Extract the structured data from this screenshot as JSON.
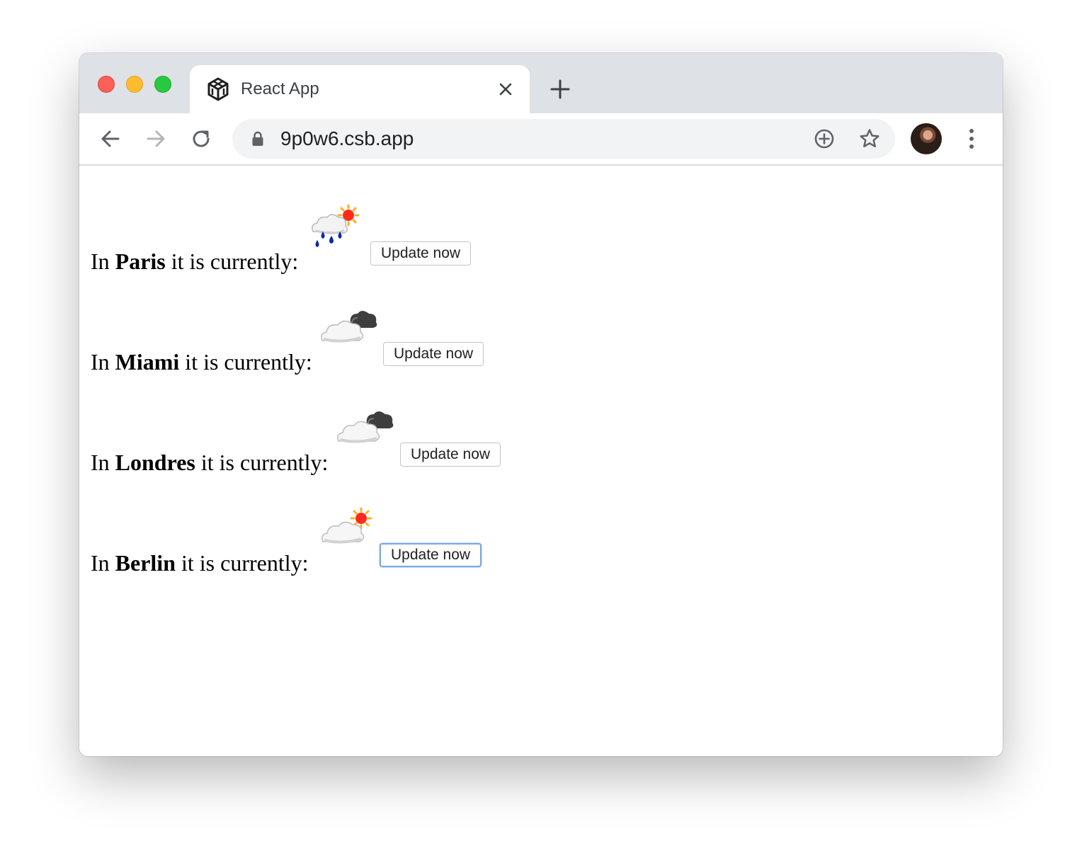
{
  "browser": {
    "tab_title": "React App",
    "url": "9p0w6.csb.app"
  },
  "content": {
    "rows": [
      {
        "prefix": "In ",
        "city": "Paris",
        "suffix": " it is currently:",
        "weather": "rain-sun-icon",
        "button_label": "Update now"
      },
      {
        "prefix": "In ",
        "city": "Miami",
        "suffix": " it is currently:",
        "weather": "cloudy-night-icon",
        "button_label": "Update now"
      },
      {
        "prefix": "In ",
        "city": "Londres",
        "suffix": " it is currently:",
        "weather": "cloudy-night-icon",
        "button_label": "Update now"
      },
      {
        "prefix": "In ",
        "city": "Berlin",
        "suffix": " it is currently:",
        "weather": "partly-sunny-icon",
        "button_label": "Update now"
      }
    ]
  },
  "colors": {
    "focus_ring": "#7aa7e6",
    "tabstrip": "#dee1e6",
    "omnibox": "#f1f3f4"
  }
}
